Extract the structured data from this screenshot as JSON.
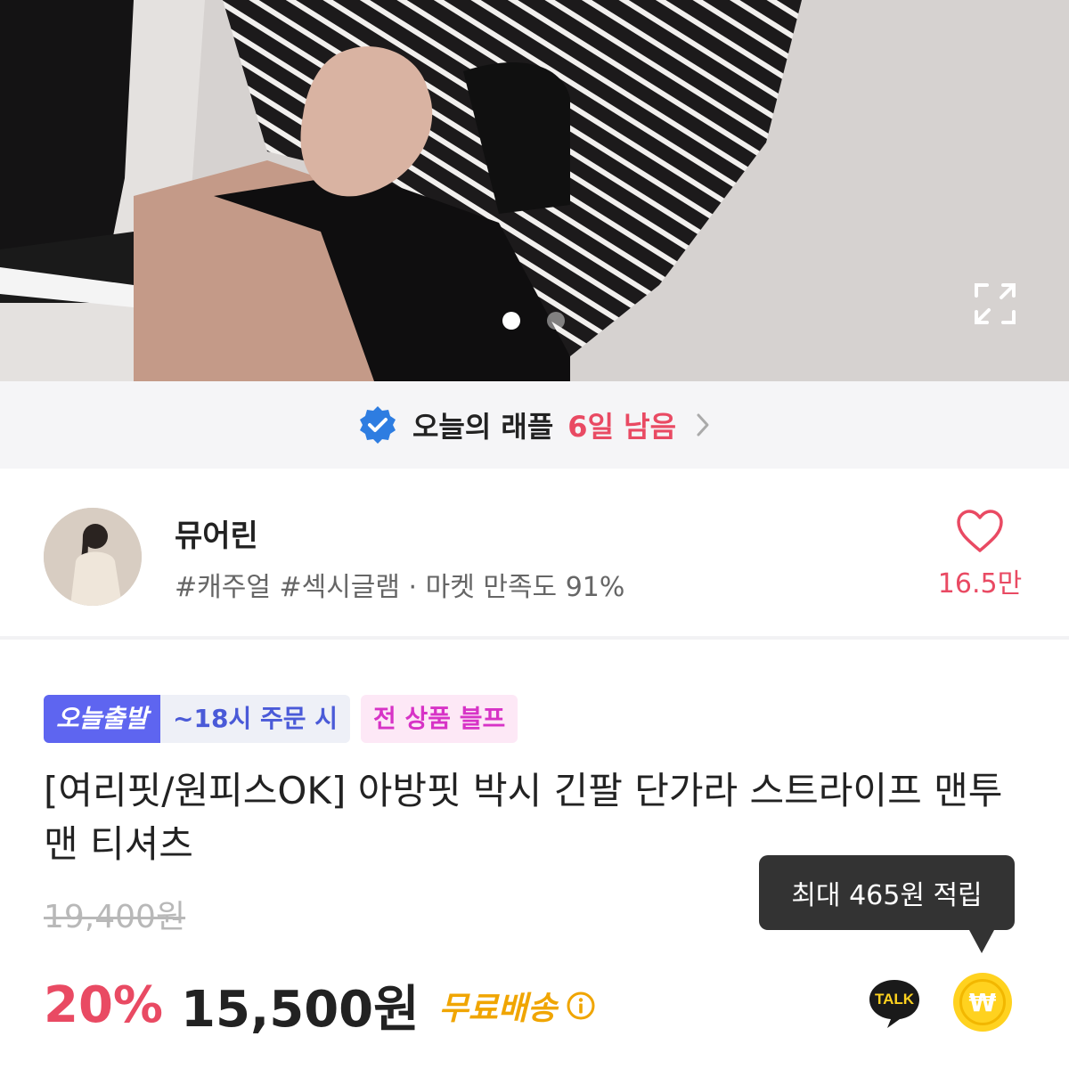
{
  "hero": {
    "slide_count": 2,
    "active_slide": 1,
    "expand_icon": "expand-icon"
  },
  "raffle": {
    "icon": "verified-badge-icon",
    "title": "오늘의 래플",
    "remaining": "6일 남음",
    "chevron_icon": "chevron-right-icon"
  },
  "store": {
    "name": "뮤어린",
    "tags": "#캐주얼 #섹시글램 · 마켓 만족도 91%",
    "like_icon": "heart-icon",
    "like_count": "16.5만"
  },
  "badges": {
    "today_ship": "오늘출발",
    "order_cutoff": "~18시 주문 시",
    "sale": "전 상품 블프"
  },
  "product": {
    "title": "[여리핏/원피스OK] 아방핏 박시 긴팔 단가라 스트라이프 맨투맨 티셔츠",
    "original_price": "19,400원",
    "discount": "20%",
    "price": "15,500원",
    "shipping": "무료배송",
    "info_icon": "info-icon"
  },
  "floating": {
    "tooltip": "최대 465원 적립",
    "talk_label": "TALK",
    "won_symbol": "₩"
  },
  "colors": {
    "accent_red": "#e94a63",
    "badge_blue": "#5e65f0",
    "badge_pink": "#d733c6",
    "shipping_orange": "#f0a500",
    "kakao_yellow": "#ffd21f"
  }
}
